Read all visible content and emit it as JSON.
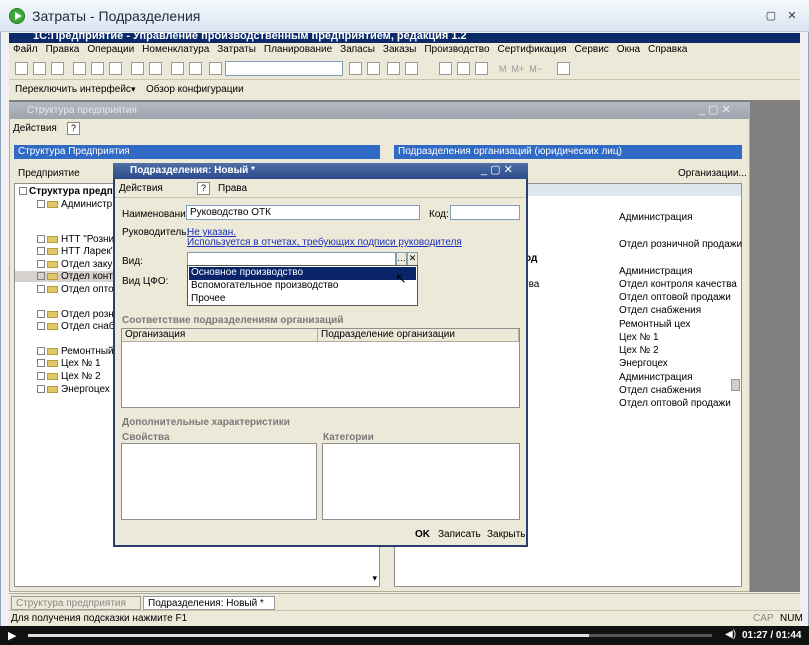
{
  "window": {
    "title": "Затраты - Подразделения"
  },
  "app": {
    "title": "1С:Предприятие - Управление производственным предприятием, редакция 1.2"
  },
  "menu": [
    "Файл",
    "Правка",
    "Операции",
    "Номенклатура",
    "Затраты",
    "Планирование",
    "Запасы",
    "Заказы",
    "Производство",
    "Сертификация",
    "Сервис",
    "Окна",
    "Справка"
  ],
  "toolbar2": {
    "switch_interface": "Переключить интерфейс",
    "config_overview": "Обзор конфигурации"
  },
  "structure_panel": {
    "title": "Структура предприятия",
    "actions": "Действия",
    "left_header": "Структура Предприятия",
    "right_header": "Подразделения организаций (юридических лиц)",
    "left_toolbar": "Предприятие",
    "right_toolbar": "Организации...",
    "tree": [
      {
        "label": "Структура предпр",
        "bold": true
      },
      {
        "label": "Администр"
      },
      {
        "label": "НТТ \"Розни"
      },
      {
        "label": "НТТ Ларек\""
      },
      {
        "label": "Отдел закуп"
      },
      {
        "label": "Отдел контр",
        "selected": true
      },
      {
        "label": "Отдел оптово"
      },
      {
        "label": "Отдел розни"
      },
      {
        "label": "Отдел снабж"
      },
      {
        "label": "Ремонтный"
      },
      {
        "label": "Цех № 1"
      },
      {
        "label": "Цех № 2"
      },
      {
        "label": "Энергоцех"
      }
    ],
    "right_rows": [
      "Администрация",
      "Отдел розничной продажи",
      "Администрация",
      "Отдел контроля качества",
      "Отдел оптовой продажи",
      "Отдел снабжения",
      "Ремонтный цех",
      "Цех № 1",
      "Цех № 2",
      "Энергоцех",
      "Администрация",
      "Отдел снабжения",
      "Отдел оптовой продажи"
    ],
    "right_fragments": [
      "вод",
      "ства",
      "ж"
    ]
  },
  "dialog": {
    "title": "Подразделения: Новый *",
    "actions": "Действия",
    "rights": "Права",
    "name_label": "Наименование:",
    "name_value": "Руководство ОТК",
    "code_label": "Код:",
    "code_value": "",
    "head_label": "Руководитель:",
    "head_link": "Не указан.",
    "head_note": "Используется в отчетах, требующих подписи руководителя",
    "kind_label": "Вид:",
    "kind_value": "",
    "cfo_label": "Вид ЦФО:",
    "dropdown": [
      "Основное производство",
      "Вспомогательное производство",
      "Прочее"
    ],
    "mapping_section": "Соответствие подразделениям организаций",
    "mapping_cols": [
      "Организация",
      "Подразделение организации"
    ],
    "extra_section": "Дополнительные характеристики",
    "properties": "Свойства",
    "categories": "Категории",
    "ok": "OK",
    "save": "Записать",
    "close": "Закрыть"
  },
  "taskbar": [
    "Структура предприятия",
    "Подразделения: Новый *"
  ],
  "status": {
    "hint": "Для получения подсказки нажмите F1",
    "cap": "CAP",
    "num": "NUM"
  },
  "player": {
    "time": "01:27 / 01:44",
    "progress": 0.82
  }
}
